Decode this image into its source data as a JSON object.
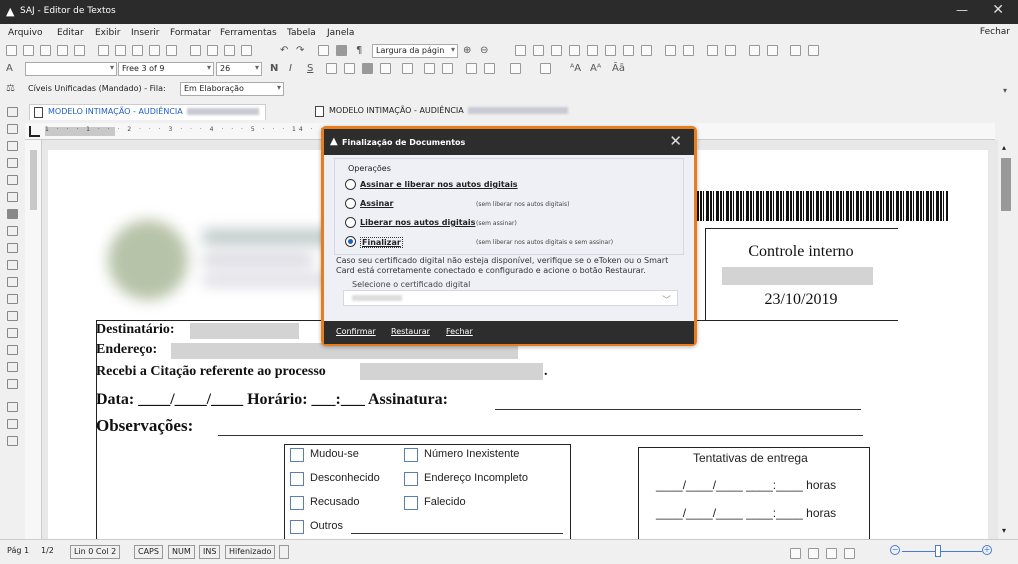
{
  "window": {
    "title": "SAJ - Editor de Textos"
  },
  "menu": {
    "items": [
      "Arquivo",
      "Editar",
      "Exibir",
      "Inserir",
      "Formatar",
      "Ferramentas",
      "Tabela",
      "Janela"
    ],
    "close": "Fechar"
  },
  "toolbar": {
    "zoom_combo": "Largura da págin",
    "font_combo": "Free 3 of 9",
    "size_combo": "26",
    "bold": "N",
    "italic": "I",
    "underline": "S",
    "queue_text": "Cíveis Unificadas (Mandado) - Fila:",
    "queue_value": "Em Elaboração"
  },
  "tabs": [
    {
      "label": "MODELO INTIMAÇÃO - AUDIÊNCIA",
      "active": true
    },
    {
      "label": "MODELO INTIMAÇÃO - AUDIÊNCIA",
      "active": false
    }
  ],
  "ruler": {
    "ticks": "1 · · · 1 · · · 2 · · · 3 · · · 4 · · · 5 · · · 14 · · · 15 · · · 16 · · · 17 · · · 18 · · · 19 · · · 20"
  },
  "document": {
    "control_title": "Controle interno",
    "control_date": "23/10/2019",
    "destinatario": "Destinatário:",
    "endereco": "Endereço:",
    "recebi": "Recebi a Citação referente ao processo",
    "recebi_end": ".",
    "data_line": "Data: ____/____/____ Horário: ___:___ Assinatura:",
    "observacoes": "Observações:",
    "options": [
      "Mudou-se",
      "Número Inexistente",
      "Desconhecido",
      "Endereço Incompleto",
      "Recusado",
      "Falecido",
      "Outros"
    ],
    "tentativas_title": "Tentativas de entrega",
    "tentativa_row": "____/____/____ ____:____ horas"
  },
  "dialog": {
    "title": "Finalização de Documentos",
    "group_label": "Operações",
    "options": [
      {
        "label": "Assinar e liberar nos autos digitais",
        "desc": "",
        "selected": false
      },
      {
        "label": "Assinar",
        "desc": "(sem liberar nos autos digitais)",
        "selected": false
      },
      {
        "label": "Liberar nos autos digitais",
        "desc": "(sem assinar)",
        "selected": false
      },
      {
        "label": "Finalizar",
        "desc": "(sem liberar nos autos digitais e sem assinar)",
        "selected": true
      }
    ],
    "note": "Caso seu certificado digital não esteja disponível, verifique se o eToken ou o Smart Card está corretamente conectado e configurado e acione o botão Restaurar.",
    "cert_label": "Selecione o certificado digital",
    "buttons": {
      "confirm": "Confirmar",
      "restore": "Restaurar",
      "close": "Fechar"
    }
  },
  "status": {
    "page": "Pág 1",
    "pages": "1/2",
    "position": "Lin 0 Col 2",
    "caps": "CAPS",
    "num": "NUM",
    "ins": "INS",
    "hyphen": "Hifenizado"
  },
  "colors": {
    "accent_orange": "#e87d1e",
    "title_dark": "#2b2b2b",
    "radio_blue": "#1f5fbf"
  }
}
